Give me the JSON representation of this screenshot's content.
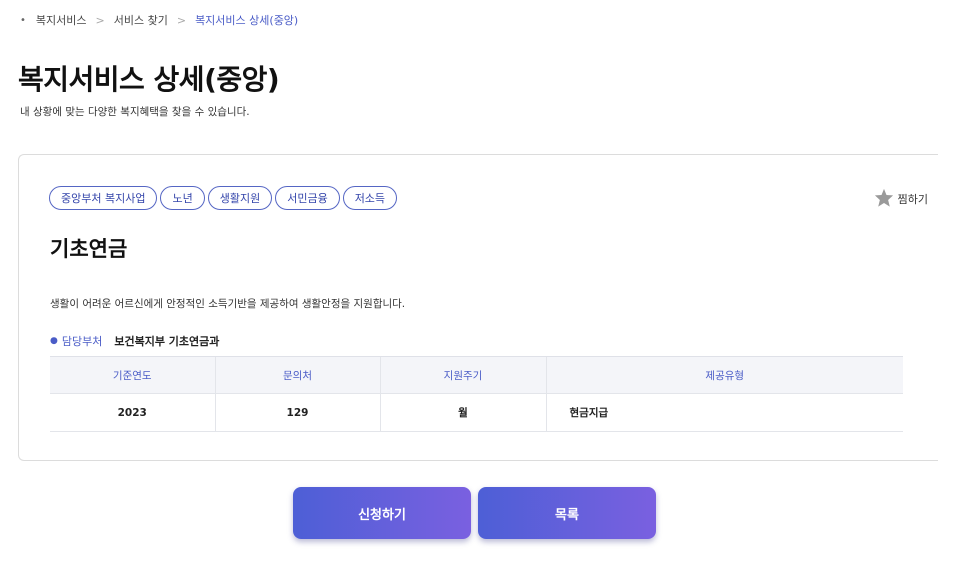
{
  "breadcrumb": {
    "items": [
      "복지서비스",
      "서비스 찾기",
      "복지서비스 상세(중앙)"
    ],
    "separator": ">"
  },
  "page": {
    "title": "복지서비스 상세(중앙)",
    "description": "내 상황에 맞는 다양한 복지혜택을 찾을 수 있습니다."
  },
  "service": {
    "tags": [
      "중앙부처 복지사업",
      "노년",
      "생활지원",
      "서민금융",
      "저소득"
    ],
    "favorite_label": "찜하기",
    "title": "기초연금",
    "description": "생활이 어려운 어르신에게 안정적인 소득기반을 제공하여 생활안정을 지원합니다.",
    "dept_label": "담당부처",
    "dept_value": "보건복지부 기초연금과",
    "table": {
      "headers": [
        "기준연도",
        "문의처",
        "지원주기",
        "제공유형"
      ],
      "row": [
        "2023",
        "129",
        "월",
        "현금지급"
      ]
    }
  },
  "actions": {
    "apply_label": "신청하기",
    "list_label": "목록"
  },
  "colors": {
    "accent": "#4a5cc7",
    "button_gradient_start": "#4d5fd6",
    "button_gradient_end": "#7a60e0",
    "star": "#9a9a9a"
  }
}
